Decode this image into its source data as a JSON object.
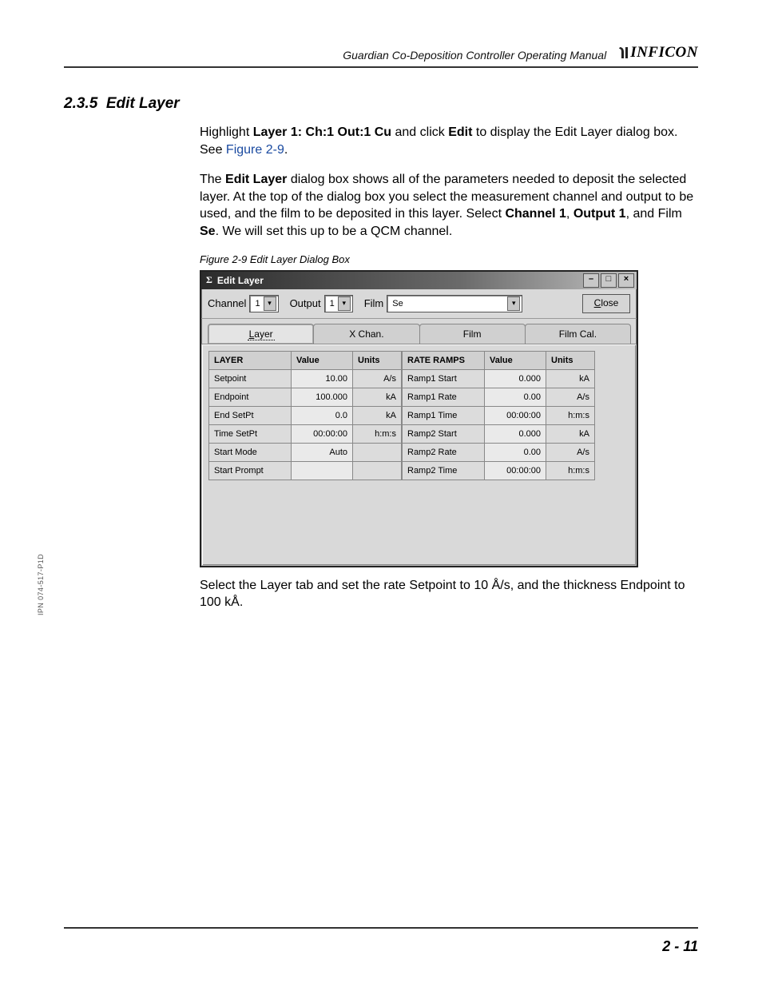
{
  "header": {
    "running_title": "Guardian Co-Deposition Controller Operating Manual",
    "logo_text": "INFICON"
  },
  "section": {
    "number": "2.3.5",
    "title": "Edit Layer"
  },
  "para1": {
    "lead": "Highlight ",
    "bold1": "Layer 1: Ch:1 Out:1 Cu",
    "mid": " and click ",
    "bold2": "Edit",
    "tail": " to display the Edit Layer dialog box. See ",
    "link": "Figure 2-9",
    "end": "."
  },
  "para2": {
    "t0": "The ",
    "b0": "Edit Layer",
    "t1": " dialog box shows all of the parameters needed to deposit the selected layer. At the top of the dialog box you select the measurement channel and output to be used, and the film to be deposited in this layer. Select ",
    "b1": "Channel 1",
    "t2": ", ",
    "b2": "Output 1",
    "t3": ", and Film ",
    "b3": "Se",
    "t4": ". We will set this up to be a QCM channel."
  },
  "figure_caption": "Figure 2-9  Edit Layer Dialog Box",
  "dialog": {
    "title": "Edit Layer",
    "win_min": "–",
    "win_max": "□",
    "win_close": "×",
    "toolbar": {
      "channel_label": "Channel",
      "channel_value": "1",
      "output_label": "Output",
      "output_value": "1",
      "film_label": "Film",
      "film_value": "Se",
      "close_prefix": "C",
      "close_rest": "lose"
    },
    "tabs": {
      "layer_prefix": "L",
      "layer_rest": "ayer",
      "xchan": "X Chan.",
      "film": "Film",
      "filmcal": "Film Cal."
    },
    "left_table": {
      "h0": "LAYER",
      "h1": "Value",
      "h2": "Units",
      "rows": [
        {
          "label": "Setpoint",
          "value": "10.00",
          "units": "A/s"
        },
        {
          "label": "Endpoint",
          "value": "100.000",
          "units": "kA"
        },
        {
          "label": "End SetPt",
          "value": "0.0",
          "units": "kA"
        },
        {
          "label": "Time SetPt",
          "value": "00:00:00",
          "units": "h:m:s"
        },
        {
          "label": "Start Mode",
          "value": "Auto",
          "units": ""
        },
        {
          "label": "Start Prompt",
          "value": "",
          "units": ""
        }
      ]
    },
    "right_table": {
      "h0": "RATE RAMPS",
      "h1": "Value",
      "h2": "Units",
      "rows": [
        {
          "label": "Ramp1 Start",
          "value": "0.000",
          "units": "kA"
        },
        {
          "label": "Ramp1 Rate",
          "value": "0.00",
          "units": "A/s"
        },
        {
          "label": "Ramp1 Time",
          "value": "00:00:00",
          "units": "h:m:s"
        },
        {
          "label": "Ramp2 Start",
          "value": "0.000",
          "units": "kA"
        },
        {
          "label": "Ramp2 Rate",
          "value": "0.00",
          "units": "A/s"
        },
        {
          "label": "Ramp2 Time",
          "value": "00:00:00",
          "units": "h:m:s"
        }
      ]
    }
  },
  "para3": "Select the Layer tab and set the rate Setpoint to 10 Å/s, and the thickness Endpoint to 100 kÅ.",
  "side_note": "IPN 074-517-P1D",
  "footer_page": "2 - 11"
}
